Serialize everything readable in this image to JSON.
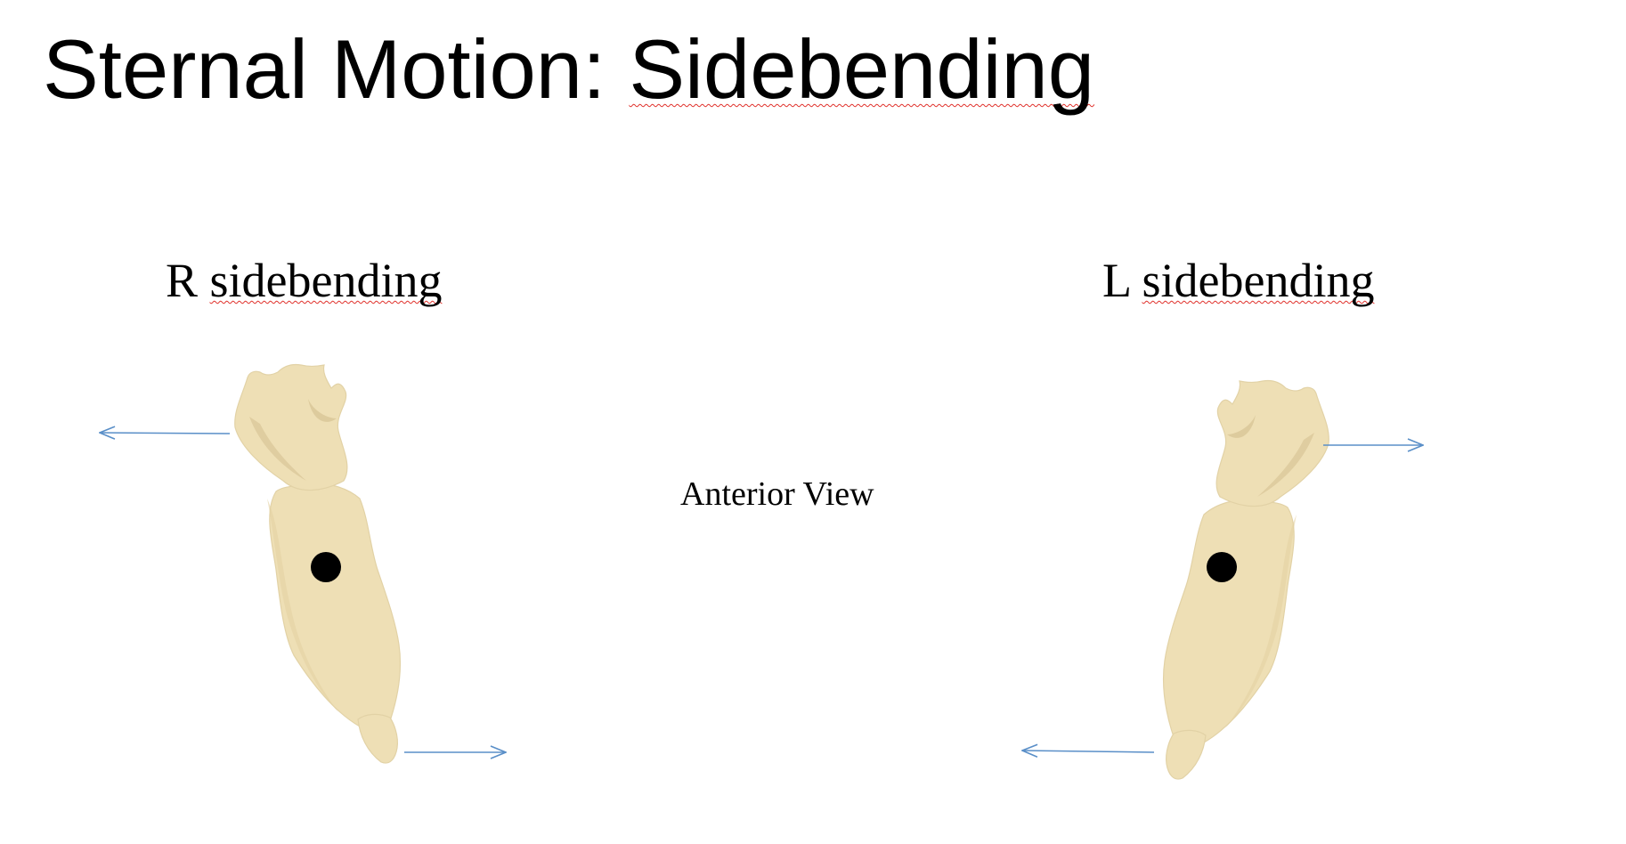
{
  "slide": {
    "title_plain": "Sternal Motion: ",
    "title_underlined": "Sidebending",
    "view_label": "Anterior View",
    "right_panel": {
      "side": "R",
      "term": "sidebending"
    },
    "left_panel": {
      "side": "L",
      "term": "sidebending"
    }
  },
  "colors": {
    "bone_fill": "#eedfb5",
    "bone_shadow": "#d8c597",
    "arrow": "#5a8fc8",
    "pivot_dot": "#000000",
    "spellcheck_underline": "#e0302a"
  },
  "icons": {
    "bone": "sternum-illustration",
    "pivot": "filled-circle",
    "arrow": "thin-line-arrow"
  }
}
